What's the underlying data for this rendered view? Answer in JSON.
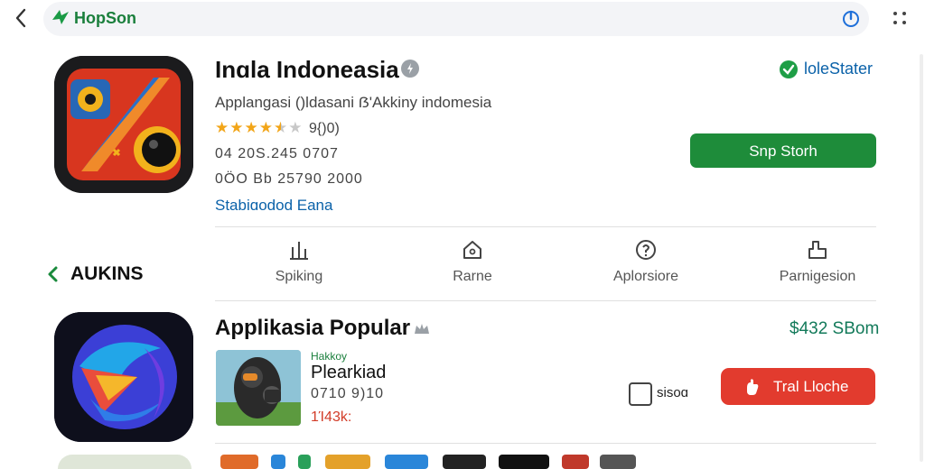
{
  "header": {
    "brand": "HopSon",
    "back_icon": "chevron-left-icon",
    "power_icon": "power-icon",
    "more_icon": "grid-dots-icon"
  },
  "featured_app": {
    "title": "Inɑla Indoneasia",
    "subtitle": "Applangasi ()ldasani ẞ'Akkiny indomesia",
    "stars": "★★★★★",
    "star_filled": 4.5,
    "rating": "9{)0)",
    "meta_line_1": "04 20S.245 0707",
    "meta_line_2": "0ÖO Bb 25790 2000",
    "developer_link": "Stabiɑodod Eana",
    "status": "loleStater",
    "install_label": "Snp Storh"
  },
  "nav": {
    "section_label": "AUKINS",
    "items": [
      {
        "label": "Spiking"
      },
      {
        "label": "Rarne"
      },
      {
        "label": "Aplorsiore"
      },
      {
        "label": "Parnigesion"
      }
    ]
  },
  "popular": {
    "title": "Applikasia Popular",
    "price": "$432 SBom",
    "item_kicker": "Hakkoy",
    "item_name": "Plearkiad",
    "item_meta": "0710 9)10",
    "item_sale": "1Ί43k:",
    "checkbox_label": "sisoɑ",
    "trial_label": "Tral Lloche"
  },
  "colors": {
    "accent_green": "#1e8c3a",
    "accent_red": "#e23b2e",
    "link_blue": "#0b62a9",
    "star": "#f2a518"
  }
}
